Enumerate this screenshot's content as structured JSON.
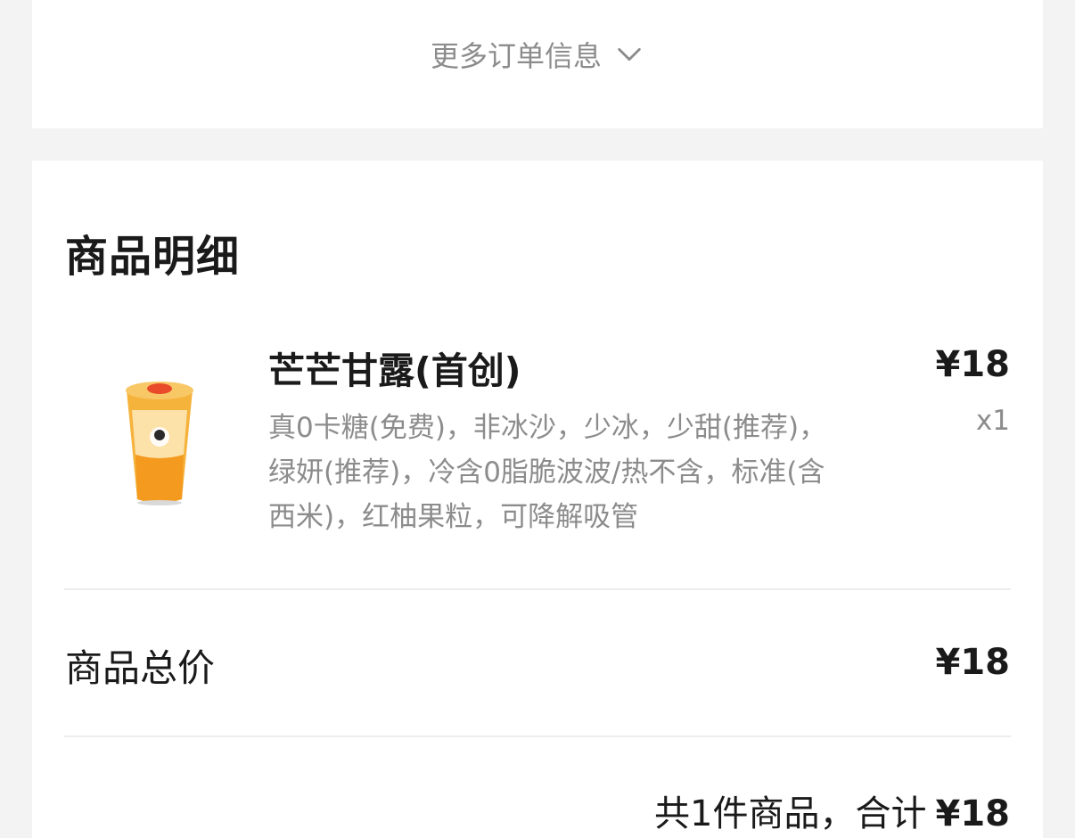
{
  "order_more": {
    "label": "更多订单信息",
    "icon": "chevron-down-icon"
  },
  "details": {
    "title": "商品明细",
    "items": [
      {
        "name": "芒芒甘露(首创)",
        "price": "¥18",
        "quantity": "x1",
        "options": "真0卡糖(免费)，非冰沙，少冰，少甜(推荐)，绿妍(推荐)，冷含0脂脆波波/热不含，标准(含西米)，红柚果粒，可降解吸管",
        "image": "drink-cup-image"
      }
    ],
    "total_label": "商品总价",
    "total_value": "¥18",
    "summary_text": "共1件商品，合计",
    "summary_amount": "¥18"
  },
  "colors": {
    "page_bg": "#f3f3f3",
    "card_bg": "#ffffff",
    "text_primary": "#1a1a1a",
    "text_secondary": "#8c8c8c",
    "divider": "#ececec"
  }
}
